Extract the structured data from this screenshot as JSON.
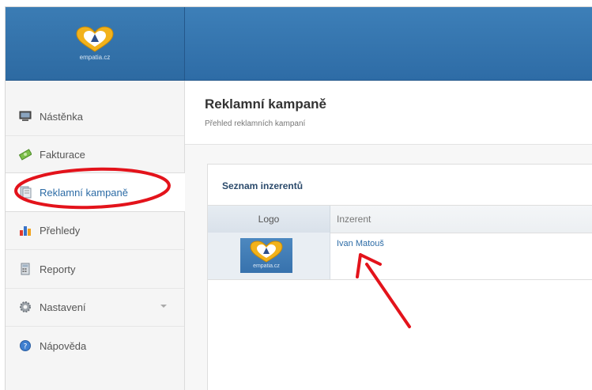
{
  "brand": {
    "logo_text": "empatia.cz"
  },
  "sidebar": {
    "items": [
      {
        "label": "Nástěnka",
        "icon": "monitor-icon"
      },
      {
        "label": "Fakturace",
        "icon": "money-icon"
      },
      {
        "label": "Reklamní kampaně",
        "icon": "document-icon"
      },
      {
        "label": "Přehledy",
        "icon": "bar-chart-icon"
      },
      {
        "label": "Reporty",
        "icon": "calculator-icon"
      },
      {
        "label": "Nastavení",
        "icon": "gear-icon"
      },
      {
        "label": "Nápověda",
        "icon": "help-icon"
      }
    ],
    "active_index": 2
  },
  "page": {
    "title": "Reklamní kampaně",
    "subtitle": "Přehled reklamních kampaní"
  },
  "panel": {
    "title": "Seznam inzerentů",
    "columns": [
      "Logo",
      "Inzerent"
    ],
    "rows": [
      {
        "logo_text": "empatia.cz",
        "advertiser": "Ivan Matouš"
      }
    ]
  },
  "colors": {
    "header": "#2e6ca6",
    "link": "#2d6ca6",
    "annotation": "#e3131b"
  }
}
